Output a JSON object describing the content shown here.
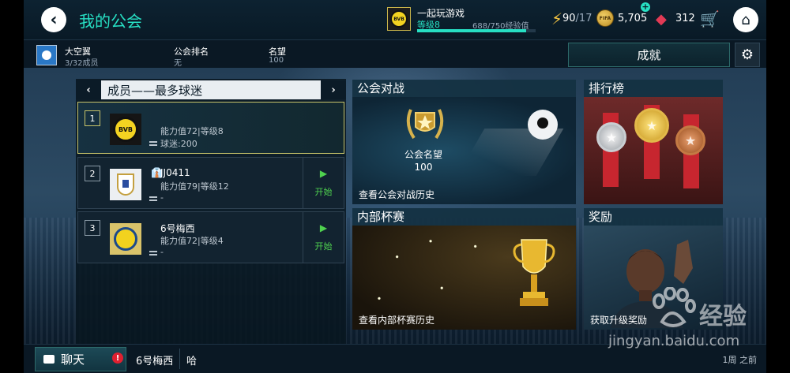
{
  "header": {
    "title": "我的公会",
    "club_name": "一起玩游戏",
    "club_level": "等级8",
    "xp_text": "688/750经验值",
    "xp_progress": 0.917,
    "energy_current": "90",
    "energy_max": "/17",
    "coins": "5,705",
    "coin_label": "FIFA",
    "gems": "312"
  },
  "info": {
    "guild_name": "大空翼",
    "guild_members": "3/32成员",
    "rank_label": "公会排名",
    "rank_value": "无",
    "fame_label": "名望",
    "fame_value": "100",
    "achievements_label": "成就"
  },
  "members": {
    "title": "成员——最多球迷",
    "prev": "‹",
    "next": "›",
    "rows": [
      {
        "rank": "1",
        "name": "",
        "stats": "能力值72|等级8",
        "fans": "球迷:200",
        "club": "BVB",
        "active": true
      },
      {
        "rank": "2",
        "name": "JJ0411",
        "stats": "能力值79|等级12",
        "fans": "-",
        "start": "开始"
      },
      {
        "rank": "3",
        "name": "6号梅西",
        "stats": "能力值72|等级4",
        "fans": "-",
        "start": "开始"
      }
    ]
  },
  "tiles": {
    "guild_war": {
      "title": "公会对战",
      "fame_label": "公会名望",
      "fame_value": "100",
      "footer": "查看公会对战历史"
    },
    "ranking": {
      "title": "排行榜"
    },
    "internal_cup": {
      "title": "内部杯赛",
      "footer": "查看内部杯赛历史"
    },
    "rewards": {
      "title": "奖励",
      "footer": "获取升级奖励"
    }
  },
  "chat": {
    "button_label": "聊天",
    "alert": "!",
    "sender": "6号梅西",
    "message": "哈",
    "time": "1周 之前"
  },
  "watermark": {
    "brand": "经验",
    "url": "jingyan.baidu.com"
  },
  "colors": {
    "accent": "#27e0c4",
    "start_green": "#4fd24f",
    "alert_red": "#e02030"
  }
}
